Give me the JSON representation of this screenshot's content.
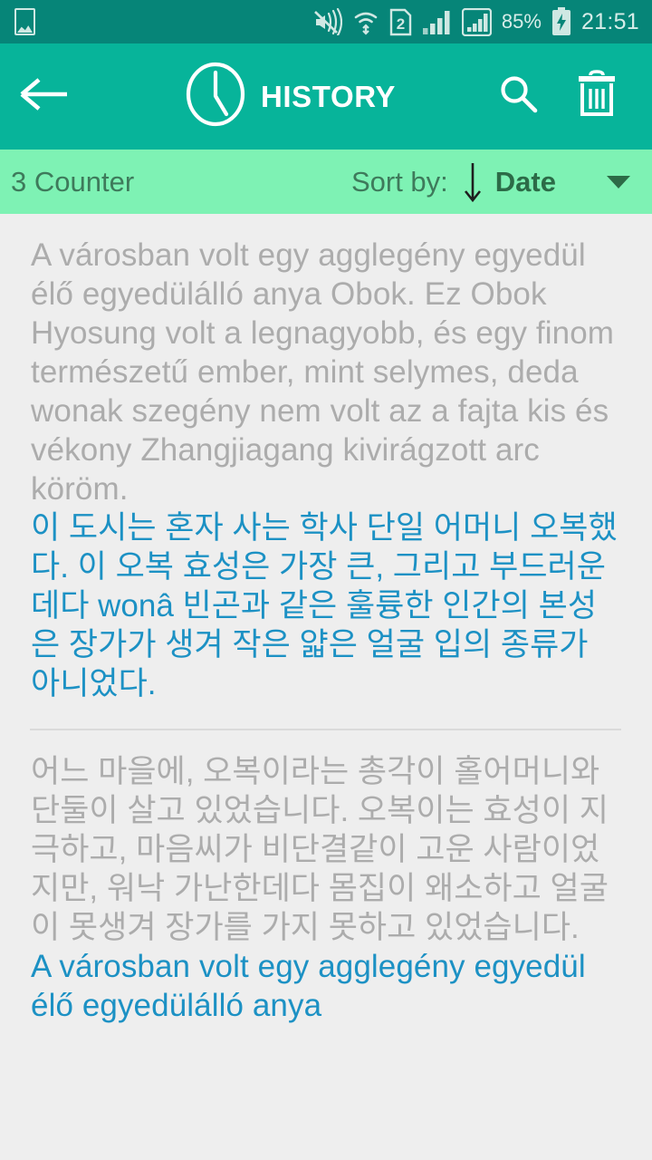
{
  "statusbar": {
    "icons_left": [
      "gallery-icon"
    ],
    "icons_right": [
      "mute-icon",
      "wifi-icon",
      "sim2-icon",
      "signal-1-icon",
      "signal-2-icon"
    ],
    "battery_pct": "85%",
    "battery_state": "charging",
    "time": "21:51",
    "bg": "#068578"
  },
  "appbar": {
    "back_icon": "arrow-left-icon",
    "clock_icon": "clock-icon",
    "title": "HISTORY",
    "search_icon": "search-icon",
    "delete_icon": "trash-icon",
    "bg": "#07B49A"
  },
  "sortbar": {
    "counter": "3 Counter",
    "sort_label": "Sort by:",
    "sort_direction_icon": "arrow-down-icon",
    "sort_value": "Date",
    "dropdown_icon": "chevron-down-icon",
    "bg": "#7EF2B4"
  },
  "entries": [
    {
      "source_text": "A városban volt egy agglegény egyedül élő egyedülálló anya Obok. Ez Obok Hyosung volt a legnagyobb, és egy finom természetű ember, mint selymes, deda wonak szegény nem volt az a fajta kis és vékony Zhangjiagang kivirágzott arc köröm.",
      "target_text": "이 도시는 혼자 사는 학사 단일 어머니 오복했다. 이 오복 효성은 가장 큰, 그리고 부드러운 데다 wonâ 빈곤과 같은 훌륭한 인간의 본성은 장가가 생겨 작은 얇은 얼굴 입의 종류가 아니었다."
    },
    {
      "source_text": "어느 마을에, 오복이라는 총각이 홀어머니와 단둘이 살고 있었습니다. 오복이는 효성이 지극하고, 마음씨가 비단결같이 고운 사람이었지만, 워낙 가난한데다 몸집이 왜소하고 얼굴이 못생겨 장가를 가지 못하고 있었습니다.",
      "target_text": "A városban volt egy agglegény egyedül élő egyedülálló anya"
    }
  ],
  "colors": {
    "source_text": "#ACACAC",
    "target_text": "#1C91C4",
    "page_bg": "#EEEEEE"
  }
}
